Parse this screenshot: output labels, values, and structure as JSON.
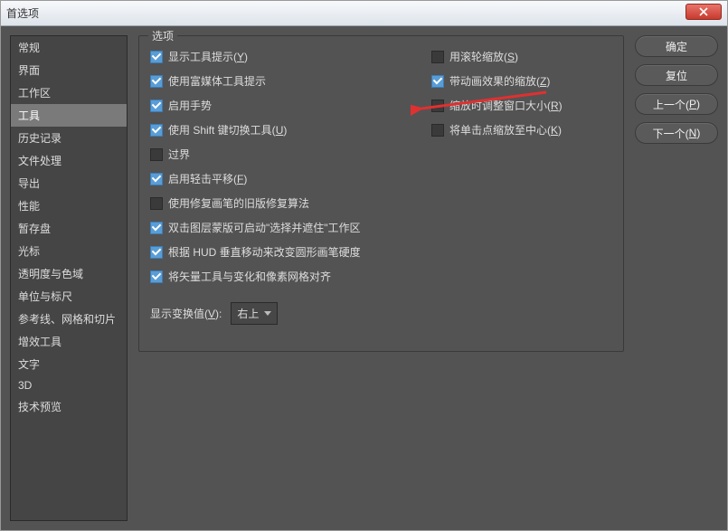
{
  "window": {
    "title": "首选项"
  },
  "sidebar": {
    "items": [
      {
        "label": "常规"
      },
      {
        "label": "界面"
      },
      {
        "label": "工作区"
      },
      {
        "label": "工具"
      },
      {
        "label": "历史记录"
      },
      {
        "label": "文件处理"
      },
      {
        "label": "导出"
      },
      {
        "label": "性能"
      },
      {
        "label": "暂存盘"
      },
      {
        "label": "光标"
      },
      {
        "label": "透明度与色域"
      },
      {
        "label": "单位与标尺"
      },
      {
        "label": "参考线、网格和切片"
      },
      {
        "label": "增效工具"
      },
      {
        "label": "文字"
      },
      {
        "label": "3D"
      },
      {
        "label": "技术预览"
      }
    ],
    "selectedIndex": 3
  },
  "options": {
    "legend": "选项",
    "left": [
      {
        "checked": true,
        "label": "显示工具提示(",
        "shortcut": "Y",
        "suffix": ")"
      },
      {
        "checked": true,
        "label": "使用富媒体工具提示"
      },
      {
        "checked": true,
        "label": "启用手势"
      },
      {
        "checked": true,
        "label": "使用 Shift 键切换工具(",
        "shortcut": "U",
        "suffix": ")"
      },
      {
        "checked": false,
        "label": "过界"
      },
      {
        "checked": true,
        "label": "启用轻击平移(",
        "shortcut": "F",
        "suffix": ")"
      },
      {
        "checked": false,
        "label": "使用修复画笔的旧版修复算法"
      },
      {
        "checked": true,
        "label": "双击图层蒙版可启动\"选择并遮住\"工作区"
      },
      {
        "checked": true,
        "label": "根据 HUD 垂直移动来改变圆形画笔硬度"
      },
      {
        "checked": true,
        "label": "将矢量工具与变化和像素网格对齐"
      }
    ],
    "right": [
      {
        "checked": false,
        "label": "用滚轮缩放(",
        "shortcut": "S",
        "suffix": ")"
      },
      {
        "checked": true,
        "label": "带动画效果的缩放(",
        "shortcut": "Z",
        "suffix": ")"
      },
      {
        "checked": false,
        "label": "缩放时调整窗口大小(",
        "shortcut": "R",
        "suffix": ")"
      },
      {
        "checked": false,
        "label": "将单击点缩放至中心(",
        "shortcut": "K",
        "suffix": ")"
      }
    ],
    "transform": {
      "label": "显示变换值(",
      "shortcut": "V",
      "suffix": "):",
      "value": "右上"
    }
  },
  "buttons": {
    "ok": "确定",
    "reset": "复位",
    "prev_pre": "上一个(",
    "prev_sc": "P",
    "prev_suf": ")",
    "next_pre": "下一个(",
    "next_sc": "N",
    "next_suf": ")"
  }
}
